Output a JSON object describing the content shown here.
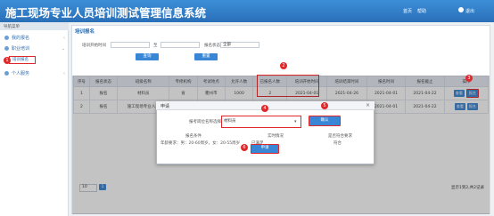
{
  "header": {
    "title": "施工现场专业人员培训测试管理信息系统",
    "links": [
      "首页",
      "帮助",
      "退出"
    ]
  },
  "sidebar": {
    "heading": "导航菜单",
    "items": [
      {
        "label": "我的报名"
      },
      {
        "label": "职业培训"
      },
      {
        "label": "培训报名"
      },
      {
        "label": "个人服务"
      }
    ]
  },
  "panel": {
    "title": "培训报名"
  },
  "filters": {
    "start_label": "培训开始时间",
    "to_label": "至",
    "status_label": "报名状态",
    "status_value": "全部",
    "query_button": "查询",
    "reset_button": "重置"
  },
  "table": {
    "columns": [
      "序号",
      "报名状态",
      "班级名称",
      "专修机构",
      "考试地点",
      "允许人数",
      "已报名人数",
      "培训开始时间",
      "培训结束时间",
      "报名时间",
      "报名截止",
      "操作"
    ],
    "rows": [
      {
        "no": "1",
        "status": "报名",
        "class": "材料员",
        "org": "省",
        "place": "衢州市",
        "allow": "1000",
        "enrolled": "2",
        "d1": "2021-04-01",
        "d2": "2021-04-26",
        "d3": "2021-04-01",
        "d4": "2021-04-22",
        "ops": [
          "查看",
          "报名"
        ]
      },
      {
        "no": "2",
        "status": "报名",
        "class": "施工现场专业人员",
        "org": "",
        "place": "衢州市",
        "allow": "",
        "enrolled": "",
        "d1": "2021-04-01",
        "d2": "2021-04-26",
        "d3": "2021-04-01",
        "d4": "2021-04-22",
        "ops": [
          "查看",
          "报名"
        ]
      }
    ]
  },
  "modal": {
    "title": "申请",
    "position_label": "报考岗位名称选择",
    "position_value": "材料员",
    "confirm_button": "确认",
    "cols": [
      "报名条件",
      "实时情况",
      "是否符合要求"
    ],
    "condition_text": "年龄要求：男：20-60周岁，女：20-55周岁",
    "actual_text": "已满足",
    "match_text": "符合",
    "submit_button": "申请"
  },
  "callouts": [
    "1",
    "2",
    "3",
    "4",
    "5",
    "6"
  ],
  "footer": {
    "page_size": "10",
    "pager": "1",
    "summary": "显示1到2,共2记录"
  }
}
